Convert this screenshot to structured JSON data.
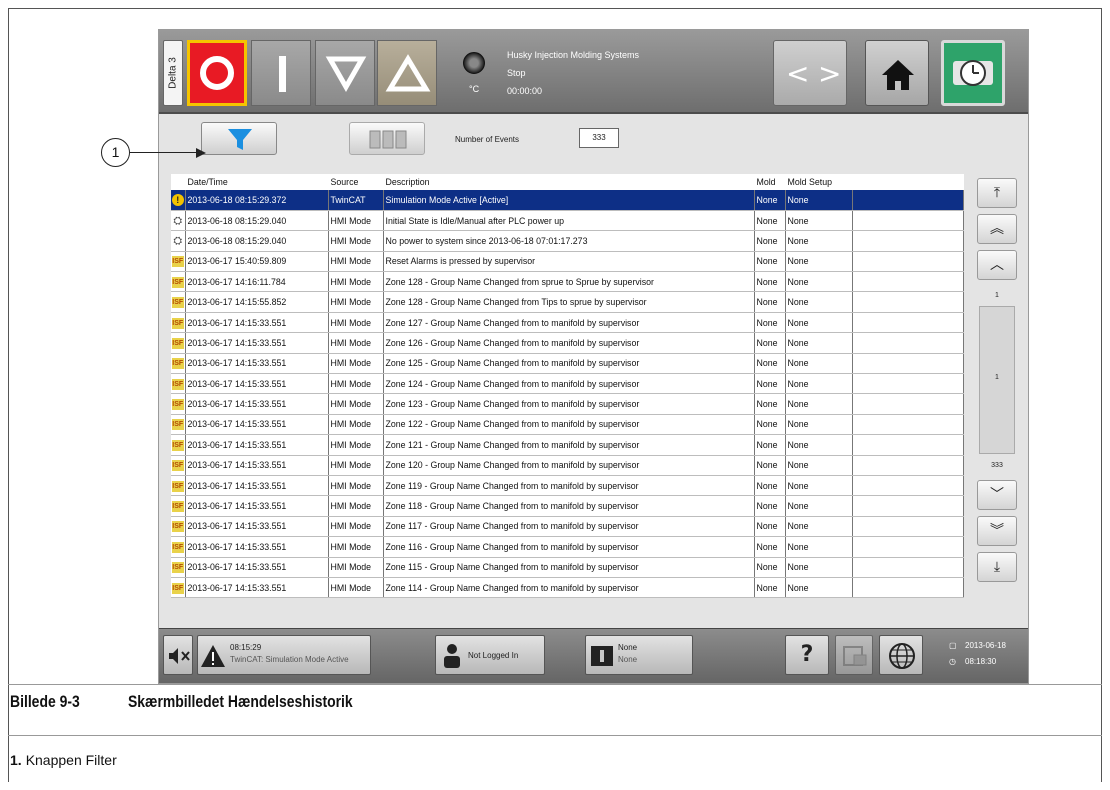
{
  "header": {
    "station_tab": "Delta 3",
    "company": "Husky Injection Molding Systems",
    "state": "Stop",
    "cycle_time": "00:00:00",
    "temp_unit": "°C",
    "nav_back": "<",
    "nav_fwd": ">"
  },
  "toolbar": {
    "events_label": "Number of Events",
    "events_count": "333"
  },
  "table": {
    "columns": [
      "Date/Time",
      "Source",
      "Description",
      "Mold",
      "Mold Setup"
    ],
    "rows": [
      {
        "icon": "warning-icon",
        "date": "2013-06-18 08:15:29.372",
        "source": "TwinCAT",
        "desc": "Simulation Mode Active [Active]",
        "mold": "None",
        "setup": "None"
      },
      {
        "icon": "plc-event-icon",
        "date": "2013-06-18 08:15:29.040",
        "source": "HMI Mode",
        "desc": "Initial State is Idle/Manual after PLC power up",
        "mold": "None",
        "setup": "None"
      },
      {
        "icon": "plc-event-icon",
        "date": "2013-06-18 08:15:29.040",
        "source": "HMI Mode",
        "desc": "No power to system since 2013-06-18 07:01:17.273",
        "mold": "None",
        "setup": "None"
      },
      {
        "icon": "hmi-event-icon",
        "date": "2013-06-17 15:40:59.809",
        "source": "HMI Mode",
        "desc": "Reset Alarms is pressed by supervisor",
        "mold": "None",
        "setup": "None"
      },
      {
        "icon": "hmi-event-icon",
        "date": "2013-06-17 14:16:11.784",
        "source": "HMI Mode",
        "desc": "Zone 128 - Group Name Changed from sprue to Sprue  by supervisor",
        "mold": "None",
        "setup": "None"
      },
      {
        "icon": "hmi-event-icon",
        "date": "2013-06-17 14:15:55.852",
        "source": "HMI Mode",
        "desc": "Zone 128 - Group Name Changed from Tips to sprue  by supervisor",
        "mold": "None",
        "setup": "None"
      },
      {
        "icon": "hmi-event-icon",
        "date": "2013-06-17 14:15:33.551",
        "source": "HMI Mode",
        "desc": "Zone 127 - Group Name Changed from  to manifold  by supervisor",
        "mold": "None",
        "setup": "None"
      },
      {
        "icon": "hmi-event-icon",
        "date": "2013-06-17 14:15:33.551",
        "source": "HMI Mode",
        "desc": "Zone 126 - Group Name Changed from  to manifold  by supervisor",
        "mold": "None",
        "setup": "None"
      },
      {
        "icon": "hmi-event-icon",
        "date": "2013-06-17 14:15:33.551",
        "source": "HMI Mode",
        "desc": "Zone 125 - Group Name Changed from  to manifold  by supervisor",
        "mold": "None",
        "setup": "None"
      },
      {
        "icon": "hmi-event-icon",
        "date": "2013-06-17 14:15:33.551",
        "source": "HMI Mode",
        "desc": "Zone 124 - Group Name Changed from  to manifold  by supervisor",
        "mold": "None",
        "setup": "None"
      },
      {
        "icon": "hmi-event-icon",
        "date": "2013-06-17 14:15:33.551",
        "source": "HMI Mode",
        "desc": "Zone 123 - Group Name Changed from  to manifold  by supervisor",
        "mold": "None",
        "setup": "None"
      },
      {
        "icon": "hmi-event-icon",
        "date": "2013-06-17 14:15:33.551",
        "source": "HMI Mode",
        "desc": "Zone 122 - Group Name Changed from  to manifold  by supervisor",
        "mold": "None",
        "setup": "None"
      },
      {
        "icon": "hmi-event-icon",
        "date": "2013-06-17 14:15:33.551",
        "source": "HMI Mode",
        "desc": "Zone 121 - Group Name Changed from  to manifold  by supervisor",
        "mold": "None",
        "setup": "None"
      },
      {
        "icon": "hmi-event-icon",
        "date": "2013-06-17 14:15:33.551",
        "source": "HMI Mode",
        "desc": "Zone 120 - Group Name Changed from  to manifold  by supervisor",
        "mold": "None",
        "setup": "None"
      },
      {
        "icon": "hmi-event-icon",
        "date": "2013-06-17 14:15:33.551",
        "source": "HMI Mode",
        "desc": "Zone 119 - Group Name Changed from  to manifold  by supervisor",
        "mold": "None",
        "setup": "None"
      },
      {
        "icon": "hmi-event-icon",
        "date": "2013-06-17 14:15:33.551",
        "source": "HMI Mode",
        "desc": "Zone 118 - Group Name Changed from  to manifold  by supervisor",
        "mold": "None",
        "setup": "None"
      },
      {
        "icon": "hmi-event-icon",
        "date": "2013-06-17 14:15:33.551",
        "source": "HMI Mode",
        "desc": "Zone 117 - Group Name Changed from  to manifold  by supervisor",
        "mold": "None",
        "setup": "None"
      },
      {
        "icon": "hmi-event-icon",
        "date": "2013-06-17 14:15:33.551",
        "source": "HMI Mode",
        "desc": "Zone 116 - Group Name Changed from  to manifold  by supervisor",
        "mold": "None",
        "setup": "None"
      },
      {
        "icon": "hmi-event-icon",
        "date": "2013-06-17 14:15:33.551",
        "source": "HMI Mode",
        "desc": "Zone 115 - Group Name Changed from  to manifold  by supervisor",
        "mold": "None",
        "setup": "None"
      },
      {
        "icon": "hmi-event-icon",
        "date": "2013-06-17 14:15:33.551",
        "source": "HMI Mode",
        "desc": "Zone 114 - Group Name Changed from  to manifold  by supervisor",
        "mold": "None",
        "setup": "None"
      }
    ]
  },
  "scroll": {
    "page_top": "1",
    "page_current": "1",
    "page_total": "333",
    "top_icon": "first-page-icon",
    "fast_up_icon": "double-chevron-up-icon",
    "up_icon": "chevron-up-icon",
    "down_icon": "chevron-down-icon",
    "fast_down_icon": "double-chevron-down-icon",
    "bottom_icon": "last-page-icon"
  },
  "footer": {
    "alarm_time": "08:15:29",
    "alarm_text": "TwinCAT: Simulation Mode Active",
    "user": "Not Logged In",
    "mold_line1": "None",
    "mold_line2": "None",
    "help": "?",
    "date": "2013-06-18",
    "time": "08:18:30"
  },
  "document": {
    "callout": "1",
    "figure_number": "Billede 9-3",
    "figure_title": "Skærmbilledet Hændelseshistorik",
    "legend_number": "1.",
    "legend_text": "Knappen Filter"
  },
  "colors": {
    "selected_row": "#0d2f86",
    "stop_button": "#e81a24",
    "stop_border": "#f5c400",
    "filter_icon": "#1a8fe0",
    "clock_button": "#2ea36a"
  }
}
